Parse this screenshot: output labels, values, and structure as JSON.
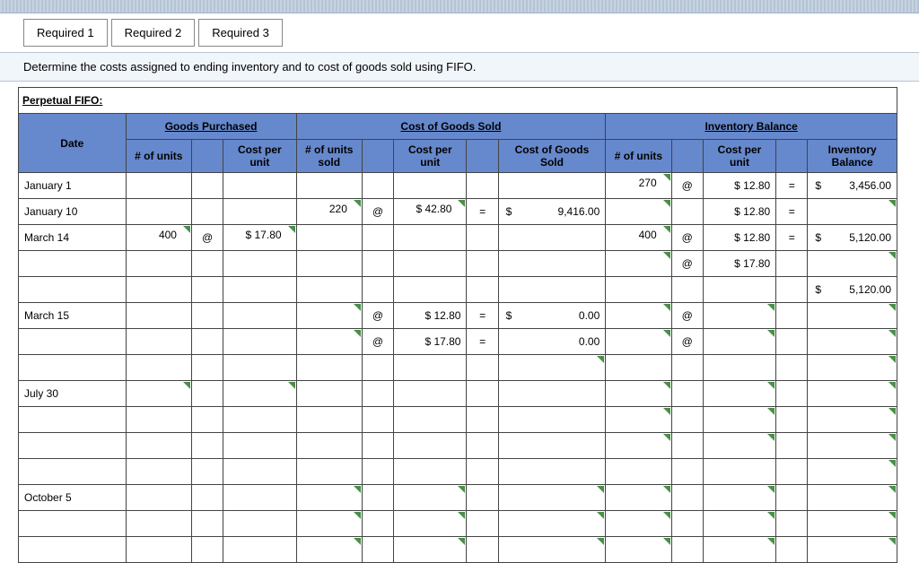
{
  "tabs": {
    "t1": "Required 1",
    "t2": "Required 2",
    "t3": "Required 3"
  },
  "instruction": "Determine the costs assigned to ending inventory and to cost of goods sold using FIFO.",
  "section_title": "Perpetual FIFO:",
  "group_headers": {
    "gp": "Goods Purchased",
    "cogs": "Cost of Goods Sold",
    "inv": "Inventory Balance"
  },
  "col_headers": {
    "date": "Date",
    "gp_units": "# of units",
    "gp_cost": "Cost per unit",
    "cogs_units": "# of units sold",
    "cogs_cost": "Cost per unit",
    "cogs_total": "Cost of Goods Sold",
    "inv_units": "# of units",
    "inv_cost": "Cost per unit",
    "inv_bal": "Inventory Balance"
  },
  "sym": {
    "at": "@",
    "eq": "=",
    "ds": "$"
  },
  "rows": {
    "jan1": {
      "date": "January 1",
      "inv_units": "270",
      "inv_cost": "$ 12.80",
      "inv_bal": "3,456.00"
    },
    "jan10": {
      "date": "January 10",
      "cogs_units": "220",
      "cogs_cost": "$ 42.80",
      "cogs_total": "9,416.00",
      "inv_cost": "$ 12.80"
    },
    "mar14a": {
      "date": "March 14",
      "gp_units": "400",
      "gp_cost": "$ 17.80",
      "inv_units": "400",
      "inv_cost": "$ 12.80",
      "inv_bal": "5,120.00"
    },
    "mar14b": {
      "inv_cost": "$ 17.80"
    },
    "mar14c": {
      "inv_bal": "5,120.00"
    },
    "mar15a": {
      "date": "March 15",
      "cogs_cost": "$ 12.80",
      "cogs_total": "0.00"
    },
    "mar15b": {
      "cogs_cost": "$ 17.80",
      "cogs_total": "0.00"
    },
    "jul30": {
      "date": "July 30"
    },
    "oct5": {
      "date": "October 5"
    }
  }
}
